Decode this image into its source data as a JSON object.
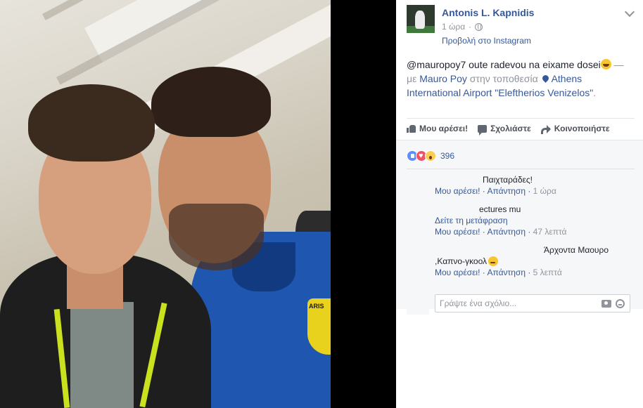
{
  "post": {
    "author": "Antonis L. Kapnidis",
    "time": "1 ώρα",
    "via": "Προβολή στο Instagram",
    "text_main": "@mauropoy7 oute radevou na eixame dosei",
    "text_dash": " —",
    "text_with": "με ",
    "tagged_person": "Mauro Poy",
    "text_location_prefix": " στην τοποθεσία ",
    "location": "Athens International Airport \"Eleftherios Venizelos\"",
    "text_end": "."
  },
  "actions": {
    "like": "Μου αρέσει!",
    "comment": "Σχολιάστε",
    "share": "Κοινοποιήστε"
  },
  "reactions": {
    "count": "396",
    "types": [
      "like",
      "love",
      "wow"
    ]
  },
  "comments": [
    {
      "text": "Παιχταράδες!",
      "like": "Μου αρέσει!",
      "reply": "Απάντηση",
      "time": "1 ώρα"
    },
    {
      "text": "ectures mu",
      "translate": "Δείτε τη μετάφραση",
      "like": "Μου αρέσει!",
      "reply": "Απάντηση",
      "time": "47 λεπτά"
    },
    {
      "text_line1": "Άρχοντα Μαουρο",
      "text_line2": ",Καπνο-γκοολ",
      "like": "Μου αρέσει!",
      "reply": "Απάντηση",
      "time": "5 λεπτά"
    }
  ],
  "write_comment": {
    "placeholder": "Γράψτε ένα σχόλιο..."
  },
  "photo": {
    "badge_text": "ARIS"
  },
  "colors": {
    "link": "#365899",
    "muted": "#90949c",
    "background_panel": "#ffffff",
    "comment_area": "#f6f7f9"
  }
}
